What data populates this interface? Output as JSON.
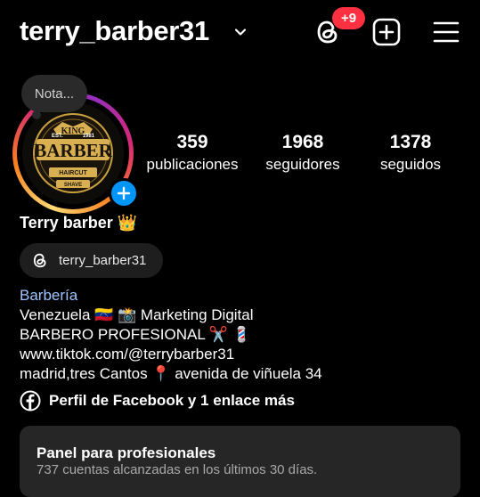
{
  "header": {
    "username": "terry_barber31",
    "notification_count": "+9",
    "icons": [
      "chevron-down-icon",
      "threads-icon",
      "add-post-icon",
      "menu-icon"
    ]
  },
  "note": {
    "label": "Nota..."
  },
  "avatar": {
    "logo": {
      "est": "EST.",
      "king": "KING",
      "year": "1981",
      "main": "BARBER",
      "haircut": "HAIRCUT",
      "shave": "SHAVE"
    }
  },
  "stats": [
    {
      "value": "359",
      "label": "publicaciones"
    },
    {
      "value": "1968",
      "label": "seguidores"
    },
    {
      "value": "1378",
      "label": "seguidos"
    }
  ],
  "profile": {
    "display_name": "Terry barber 👑",
    "threads_handle": "terry_barber31",
    "category": "Barbería",
    "bio_lines": [
      "Venezuela 🇻🇪 📸 Marketing Digital",
      "BARBERO PROFESIONAL ✂️ 💈",
      "www.tiktok.com/@terrybarber31",
      "madrid,tres Cantos 📍 avenida de viñuela 34"
    ],
    "links_text": "Perfil de Facebook y 1 enlace más"
  },
  "panel": {
    "title": "Panel para profesionales",
    "subtitle": "737 cuentas alcanzadas en los últimos 30 días."
  },
  "colors": {
    "background": "#000000",
    "badge": "#ff3040",
    "add_story": "#0095f6",
    "category": "#9fc4ff",
    "pill": "#1e1e1e",
    "panel": "#262626"
  }
}
